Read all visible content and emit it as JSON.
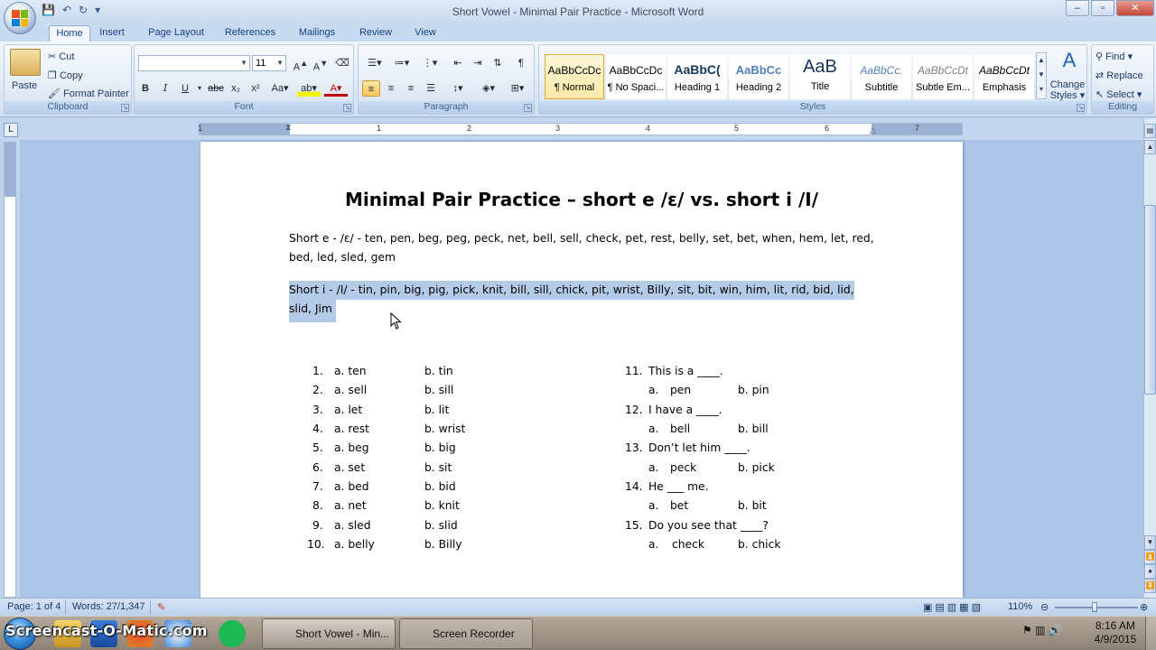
{
  "window": {
    "title": "Short Vowel - Minimal Pair Practice - Microsoft Word",
    "minimize": "–",
    "maximize": "▫",
    "close": "✕"
  },
  "tabs": [
    "Home",
    "Insert",
    "Page Layout",
    "References",
    "Mailings",
    "Review",
    "View"
  ],
  "ribbon": {
    "clipboard": {
      "label": "Clipboard",
      "paste": "Paste",
      "cut": "Cut",
      "copy": "Copy",
      "format_painter": "Format Painter"
    },
    "font": {
      "label": "Font",
      "font_name": "",
      "font_size": "11"
    },
    "paragraph": {
      "label": "Paragraph"
    },
    "styles": {
      "label": "Styles",
      "items": [
        {
          "sample": "AaBbCcDc",
          "name": "¶ Normal"
        },
        {
          "sample": "AaBbCcDc",
          "name": "¶ No Spaci..."
        },
        {
          "sample": "AaBbC(",
          "name": "Heading 1"
        },
        {
          "sample": "AaBbCc",
          "name": "Heading 2"
        },
        {
          "sample": "AaB",
          "name": "Title"
        },
        {
          "sample": "AaBbCc.",
          "name": "Subtitle"
        },
        {
          "sample": "AaBbCcDt",
          "name": "Subtle Em..."
        },
        {
          "sample": "AaBbCcDt",
          "name": "Emphasis"
        }
      ],
      "change_styles_1": "Change",
      "change_styles_2": "Styles ▾"
    },
    "editing": {
      "label": "Editing",
      "find": "Find ▾",
      "replace": "Replace",
      "select": "Select ▾"
    }
  },
  "ruler": {
    "numbers": [
      "1",
      "1",
      "2",
      "3",
      "4",
      "5",
      "6",
      "7"
    ]
  },
  "document": {
    "title": "Minimal Pair Practice – short e /ɛ/ vs. short i /I/",
    "short_e_line1": "Short e - /ɛ/ - ten, pen, beg, peg, peck, net, bell, sell, check, pet, rest, belly, set, bet, when, hem, let, red,",
    "short_e_line2": "bed, led, sled, gem",
    "short_i_line1": "Short i - /I/ - tin, pin, big, pig, pick, knit, bill, sill, chick, pit, wrist, Billy, sit, bit, win, him, lit, rid, bid, lid,",
    "short_i_line2": "slid, Jim",
    "pairs": [
      {
        "n": "1.",
        "a": "a. ten",
        "b": "b. tin"
      },
      {
        "n": "2.",
        "a": "a. sell",
        "b": "b. sill"
      },
      {
        "n": "3.",
        "a": "a. let",
        "b": "b. lit"
      },
      {
        "n": "4.",
        "a": "a. rest",
        "b": "b. wrist"
      },
      {
        "n": "5.",
        "a": "a. beg",
        "b": "b. big"
      },
      {
        "n": "6.",
        "a": "a. set",
        "b": "b. sit"
      },
      {
        "n": "7.",
        "a": "a. bed",
        "b": "b. bid"
      },
      {
        "n": "8.",
        "a": "a. net",
        "b": "b. knit"
      },
      {
        "n": "9.",
        "a": "a. sled",
        "b": "b. slid"
      },
      {
        "n": "10.",
        "a": "a. belly",
        "b": "b. Billy"
      }
    ],
    "sentences": [
      {
        "n": "11.",
        "q": "This is a ____.",
        "a": "pen",
        "b": "b. pin"
      },
      {
        "n": "12.",
        "q": "I have a ____.",
        "a": "bell",
        "b": "b. bill"
      },
      {
        "n": "13.",
        "q": "Don’t let him ____.",
        "a": "peck",
        "b": "b. pick"
      },
      {
        "n": "14.",
        "q": "He ___ me.",
        "a": "bet",
        "b": "b. bit"
      },
      {
        "n": "15.",
        "q": "Do you see that ____?",
        "a": "check",
        "b": "b. chick"
      }
    ],
    "sub_a_label": "a."
  },
  "statusbar": {
    "page": "Page: 1 of 4",
    "words": "Words: 27/1,347",
    "zoom": "110%"
  },
  "taskbar": {
    "logo": "Screencast-O-Matic.com",
    "task1": "Short Vowel - Min...",
    "task2": "Screen Recorder",
    "time": "8:16 AM",
    "date": "4/9/2015"
  }
}
